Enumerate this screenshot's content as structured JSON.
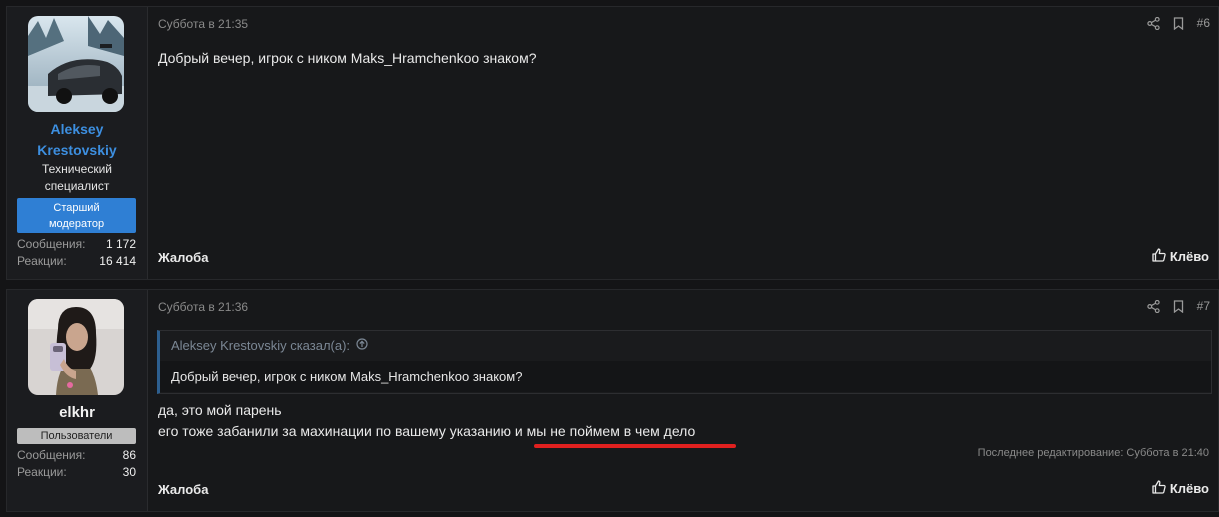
{
  "posts": [
    {
      "author": {
        "name_line1": "Aleksey",
        "name_line2": "Krestovskiy",
        "title_line1": "Технический",
        "title_line2": "специалист",
        "badge_line1": "Старший",
        "badge_line2": "модератор",
        "stats": [
          {
            "label": "Сообщения:",
            "value": "1 172"
          },
          {
            "label": "Реакции:",
            "value": "16 414"
          }
        ]
      },
      "date": "Суббота в 21:35",
      "number": "#6",
      "message": "Добрый вечер, игрок с ником Maks_Hramchenkoo знаком?",
      "report_label": "Жалоба",
      "like_label": "Клёво"
    },
    {
      "author": {
        "name": "elkhr",
        "badge": "Пользователи",
        "stats": [
          {
            "label": "Сообщения:",
            "value": "86"
          },
          {
            "label": "Реакции:",
            "value": "30"
          }
        ]
      },
      "date": "Суббота в 21:36",
      "number": "#7",
      "quote": {
        "author_label": "Aleksey Krestovskiy сказал(а):",
        "text": "Добрый вечер, игрок с ником Maks_Hramchenkoo знаком?"
      },
      "message_line1": "да, это мой парень",
      "message_line2": "его тоже забанили за махинации по вашему указанию и мы не поймем в чем дело",
      "edited": "Последнее редактирование: Суббота в 21:40",
      "report_label": "Жалоба",
      "like_label": "Клёво"
    }
  ],
  "icons": {
    "share": "share-icon",
    "bookmark": "bookmark-icon",
    "thumbs_up": "thumbs-up-icon",
    "quote_jump": "arrow-up-circle-icon"
  },
  "colors": {
    "accent_blue": "#3d8fe0",
    "badge_blue": "#2f7fd4",
    "underline_red": "#e0201f"
  }
}
